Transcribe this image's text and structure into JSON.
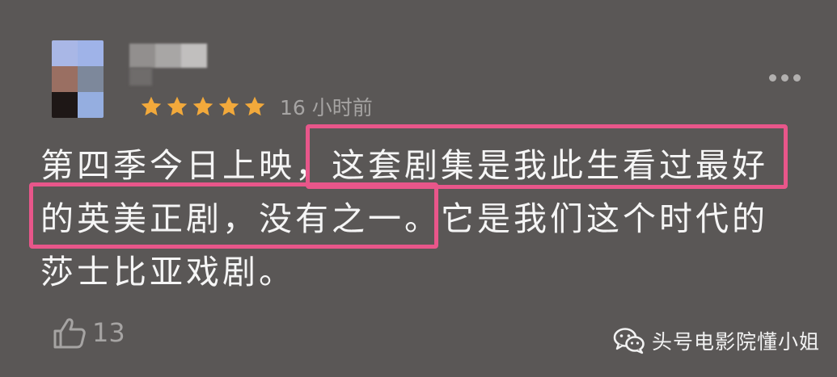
{
  "user": {
    "rating_stars": 5,
    "time_ago": "16 小时前"
  },
  "review": {
    "lines": [
      "第四季今日上映，这套剧集是我此生看过最好",
      "的英美正剧，没有之一。它是我们这个时代的",
      "莎士比亚戏剧。"
    ]
  },
  "footer": {
    "like_count": "13",
    "watermark": "头号电影院懂小姐"
  },
  "icons": {
    "more": "more-icon",
    "like": "thumbs-up-icon",
    "watermark": "wechat-icon",
    "star": "star-icon"
  },
  "colors": {
    "background": "#5a5756",
    "star": "#f2a93b",
    "highlight": "#e8568a",
    "muted_text": "#a6a4a3"
  }
}
